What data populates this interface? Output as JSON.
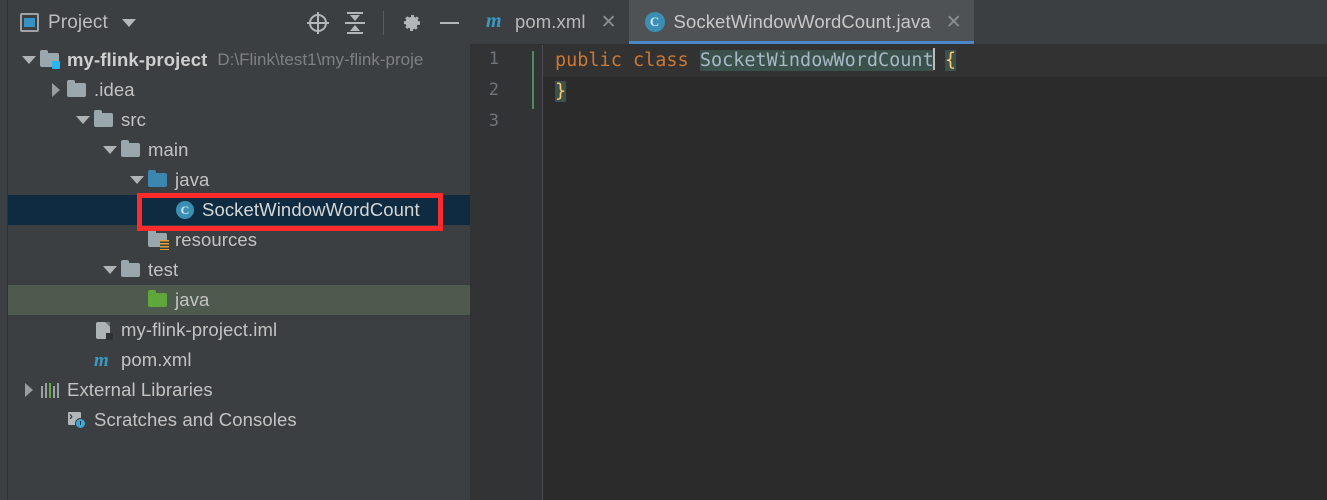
{
  "panel": {
    "title": "Project",
    "icons": {
      "project_badge": "project-icon",
      "dropdown": "chevron-down-icon",
      "locate": "locate-crosshair-icon",
      "collapse_all": "collapse-all-icon",
      "settings": "gear-icon",
      "minimize": "minimize-icon"
    }
  },
  "tree": [
    {
      "label": "my-flink-project",
      "sub": "D:\\Flink\\test1\\my-flink-proje",
      "icon": "module-folder-icon",
      "twisty": "down",
      "indent": 0,
      "bold": true,
      "state": "normal"
    },
    {
      "label": ".idea",
      "sub": "",
      "icon": "folder-icon",
      "twisty": "right",
      "indent": 1,
      "bold": false,
      "state": "normal"
    },
    {
      "label": "src",
      "sub": "",
      "icon": "folder-icon",
      "twisty": "down",
      "indent": 2,
      "bold": false,
      "state": "normal"
    },
    {
      "label": "main",
      "sub": "",
      "icon": "folder-icon",
      "twisty": "down",
      "indent": 3,
      "bold": false,
      "state": "normal"
    },
    {
      "label": "java",
      "sub": "",
      "icon": "source-folder-icon",
      "twisty": "down",
      "indent": 4,
      "bold": false,
      "state": "normal"
    },
    {
      "label": "SocketWindowWordCount",
      "sub": "",
      "icon": "java-class-icon",
      "twisty": "none",
      "indent": 5,
      "bold": false,
      "state": "selected"
    },
    {
      "label": "resources",
      "sub": "",
      "icon": "resources-folder-icon",
      "twisty": "none",
      "indent": 4,
      "bold": false,
      "state": "normal"
    },
    {
      "label": "test",
      "sub": "",
      "icon": "folder-icon",
      "twisty": "down",
      "indent": 3,
      "bold": false,
      "state": "normal"
    },
    {
      "label": "java",
      "sub": "",
      "icon": "test-source-folder-icon",
      "twisty": "none",
      "indent": 4,
      "bold": false,
      "state": "hover"
    },
    {
      "label": "my-flink-project.iml",
      "sub": "",
      "icon": "iml-file-icon",
      "twisty": "none",
      "indent": 2,
      "bold": false,
      "state": "normal"
    },
    {
      "label": "pom.xml",
      "sub": "",
      "icon": "maven-icon",
      "twisty": "none",
      "indent": 2,
      "bold": false,
      "state": "normal"
    },
    {
      "label": "External Libraries",
      "sub": "",
      "icon": "libraries-icon",
      "twisty": "right",
      "indent": 0,
      "bold": false,
      "state": "normal"
    },
    {
      "label": "Scratches and Consoles",
      "sub": "",
      "icon": "scratches-icon",
      "twisty": "none",
      "indent": 1,
      "bold": false,
      "state": "normal"
    }
  ],
  "annotation": {
    "color": "#fd2b2b",
    "target": "SocketWindowWordCount"
  },
  "tabs": [
    {
      "label": "pom.xml",
      "icon": "maven-icon",
      "close": "✕",
      "active": false
    },
    {
      "label": "SocketWindowWordCount.java",
      "icon": "java-class-icon",
      "close": "✕",
      "active": true
    }
  ],
  "editor": {
    "line_numbers": [
      "1",
      "2",
      "3"
    ],
    "code": {
      "l1_kw_public": "public",
      "l1_kw_class": "class",
      "l1_classname": "SocketWindowWordCount",
      "l1_brace": "{",
      "l2_brace": "}"
    },
    "colors": {
      "background": "#2b2b2b",
      "gutter": "#313335",
      "keyword": "#cc7832",
      "identifier": "#a9b7c6",
      "brace": "#ffc66d",
      "selection": "#3b514b",
      "caret_line": "#323232",
      "tab_underline": "#4a88c7"
    }
  }
}
